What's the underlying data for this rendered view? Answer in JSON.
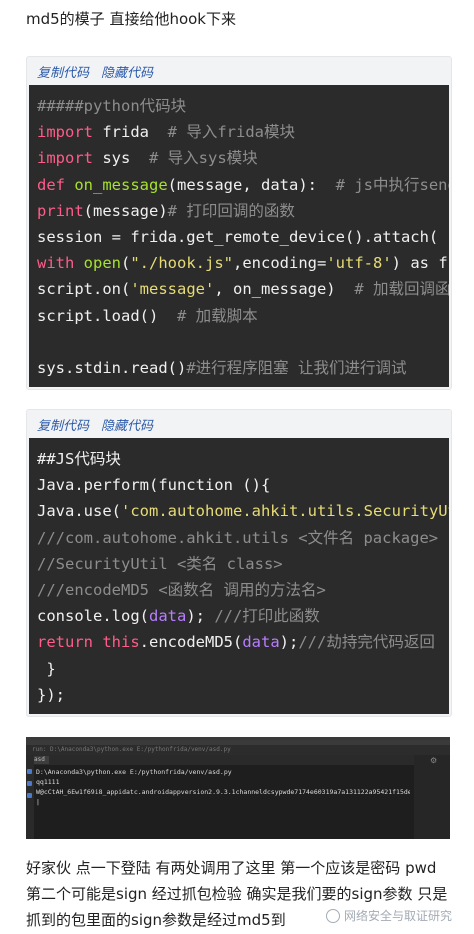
{
  "intro_text": "md5的模子  直接给他hook下来",
  "python_block": {
    "copy_label": "复制代码",
    "hide_label": "隐藏代码",
    "lines": [
      [
        {
          "t": "#####python代码块",
          "c": "cm"
        }
      ],
      [
        {
          "t": "import",
          "c": "kw"
        },
        {
          "t": " frida  "
        },
        {
          "t": "# 导入frida模块",
          "c": "cm"
        }
      ],
      [
        {
          "t": "import",
          "c": "kw"
        },
        {
          "t": " sys  "
        },
        {
          "t": "# 导入sys模块",
          "c": "cm"
        }
      ],
      [
        {
          "t": "def",
          "c": "kw"
        },
        {
          "t": " "
        },
        {
          "t": "on_message",
          "c": "fn"
        },
        {
          "t": "(message, data):  "
        },
        {
          "t": "# js中执行send函数后要回调的函数",
          "c": "cm"
        }
      ],
      [
        {
          "t": "print",
          "c": "kw"
        },
        {
          "t": "(message)"
        },
        {
          "t": "# 打印回调的函数",
          "c": "cm"
        }
      ],
      [
        {
          "t": "session = frida.get_remote_device().attach("
        }
      ],
      [
        {
          "t": "with",
          "c": "kw"
        },
        {
          "t": " "
        },
        {
          "t": "open",
          "c": "fn"
        },
        {
          "t": "("
        },
        {
          "t": "\"./hook.js\"",
          "c": "str"
        },
        {
          "t": ",encoding="
        },
        {
          "t": "'utf-8'",
          "c": "str"
        },
        {
          "t": ") as f:"
        }
      ],
      [
        {
          "t": "script.on("
        },
        {
          "t": "'message'",
          "c": "str"
        },
        {
          "t": ", on_message)  "
        },
        {
          "t": "# 加载回调函数",
          "c": "cm"
        }
      ],
      [
        {
          "t": "script.load()  "
        },
        {
          "t": "# 加载脚本",
          "c": "cm"
        }
      ],
      [
        {
          "t": " "
        }
      ],
      [
        {
          "t": "sys.stdin.read()"
        },
        {
          "t": "#进行程序阻塞 让我们进行调试",
          "c": "cm"
        }
      ]
    ]
  },
  "js_block": {
    "copy_label": "复制代码",
    "hide_label": "隐藏代码",
    "lines": [
      [
        {
          "t": "##JS代码块"
        }
      ],
      [
        {
          "t": "Java.perform(function (){"
        }
      ],
      [
        {
          "t": "Java.use("
        },
        {
          "t": "'com.autohome.ahkit.utils.SecurityUtil'",
          "c": "str"
        },
        {
          "t": ")"
        }
      ],
      [
        {
          "t": "///com.autohome.ahkit.utils <文件名 package>",
          "c": "cm"
        }
      ],
      [
        {
          "t": "//SecurityUtil <类名 class>",
          "c": "cm"
        }
      ],
      [
        {
          "t": "///encodeMD5 <函数名 调用的方法名>",
          "c": "cm"
        }
      ],
      [
        {
          "t": "console.log("
        },
        {
          "t": "data",
          "c": "pu"
        },
        {
          "t": "); "
        },
        {
          "t": "///打印此函数",
          "c": "cm"
        }
      ],
      [
        {
          "t": "return",
          "c": "kw"
        },
        {
          "t": " "
        },
        {
          "t": "this",
          "c": "kw"
        },
        {
          "t": ".encodeMD5("
        },
        {
          "t": "data",
          "c": "pu"
        },
        {
          "t": ");"
        },
        {
          "t": "///劫持完代码返回",
          "c": "cm"
        }
      ],
      [
        {
          "t": " }"
        }
      ],
      [
        {
          "t": "});"
        }
      ]
    ]
  },
  "terminal": {
    "tab_label": "asd",
    "header_text": "run: D:\\Anaconda3\\python.exe  E:/pythonfrida/venv/asd.py",
    "lines": [
      "D:\\Anaconda3\\python.exe E:/pythonfrida/venv/asd.py",
      "qq1111",
      "W@cCtAH_6Ew1f69i8_appidatc.androidappversion2.9.3.1channeldcsypwde7174e60319a7a131122a95421f15deudid+5mJY+h04mriggA",
      "|"
    ]
  },
  "outro_text": "好家伙 点一下登陆 有两处调用了这里  第一个应该是密码 pwd  第二个可能是sign 经过抓包检验 确实是我们要的sign参数 只是抓到的包里面的sign参数是经过md5到",
  "watermark": "网络安全与取证研究"
}
